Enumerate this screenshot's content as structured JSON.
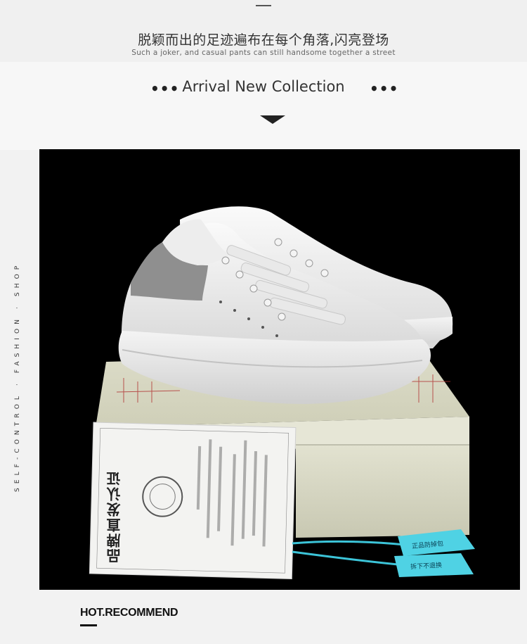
{
  "header": {
    "cn_title": "脱颖而出的足迹遍布在每个角落,闪亮登场",
    "en_subtitle": "Such a joker, and casual pants can still handsome together a street"
  },
  "section": {
    "title": "Arrival New Collection",
    "dots_left": "•••",
    "dots_right": "•••"
  },
  "side_text": "SELF-CONTROL · FASHION · SHOP",
  "product": {
    "card_title": "品牌直发认证",
    "tag_text_1": "正品防掉包",
    "tag_text_2": "拆下不退换"
  },
  "footer": {
    "recommend": "HOT.RECOMMEND"
  }
}
